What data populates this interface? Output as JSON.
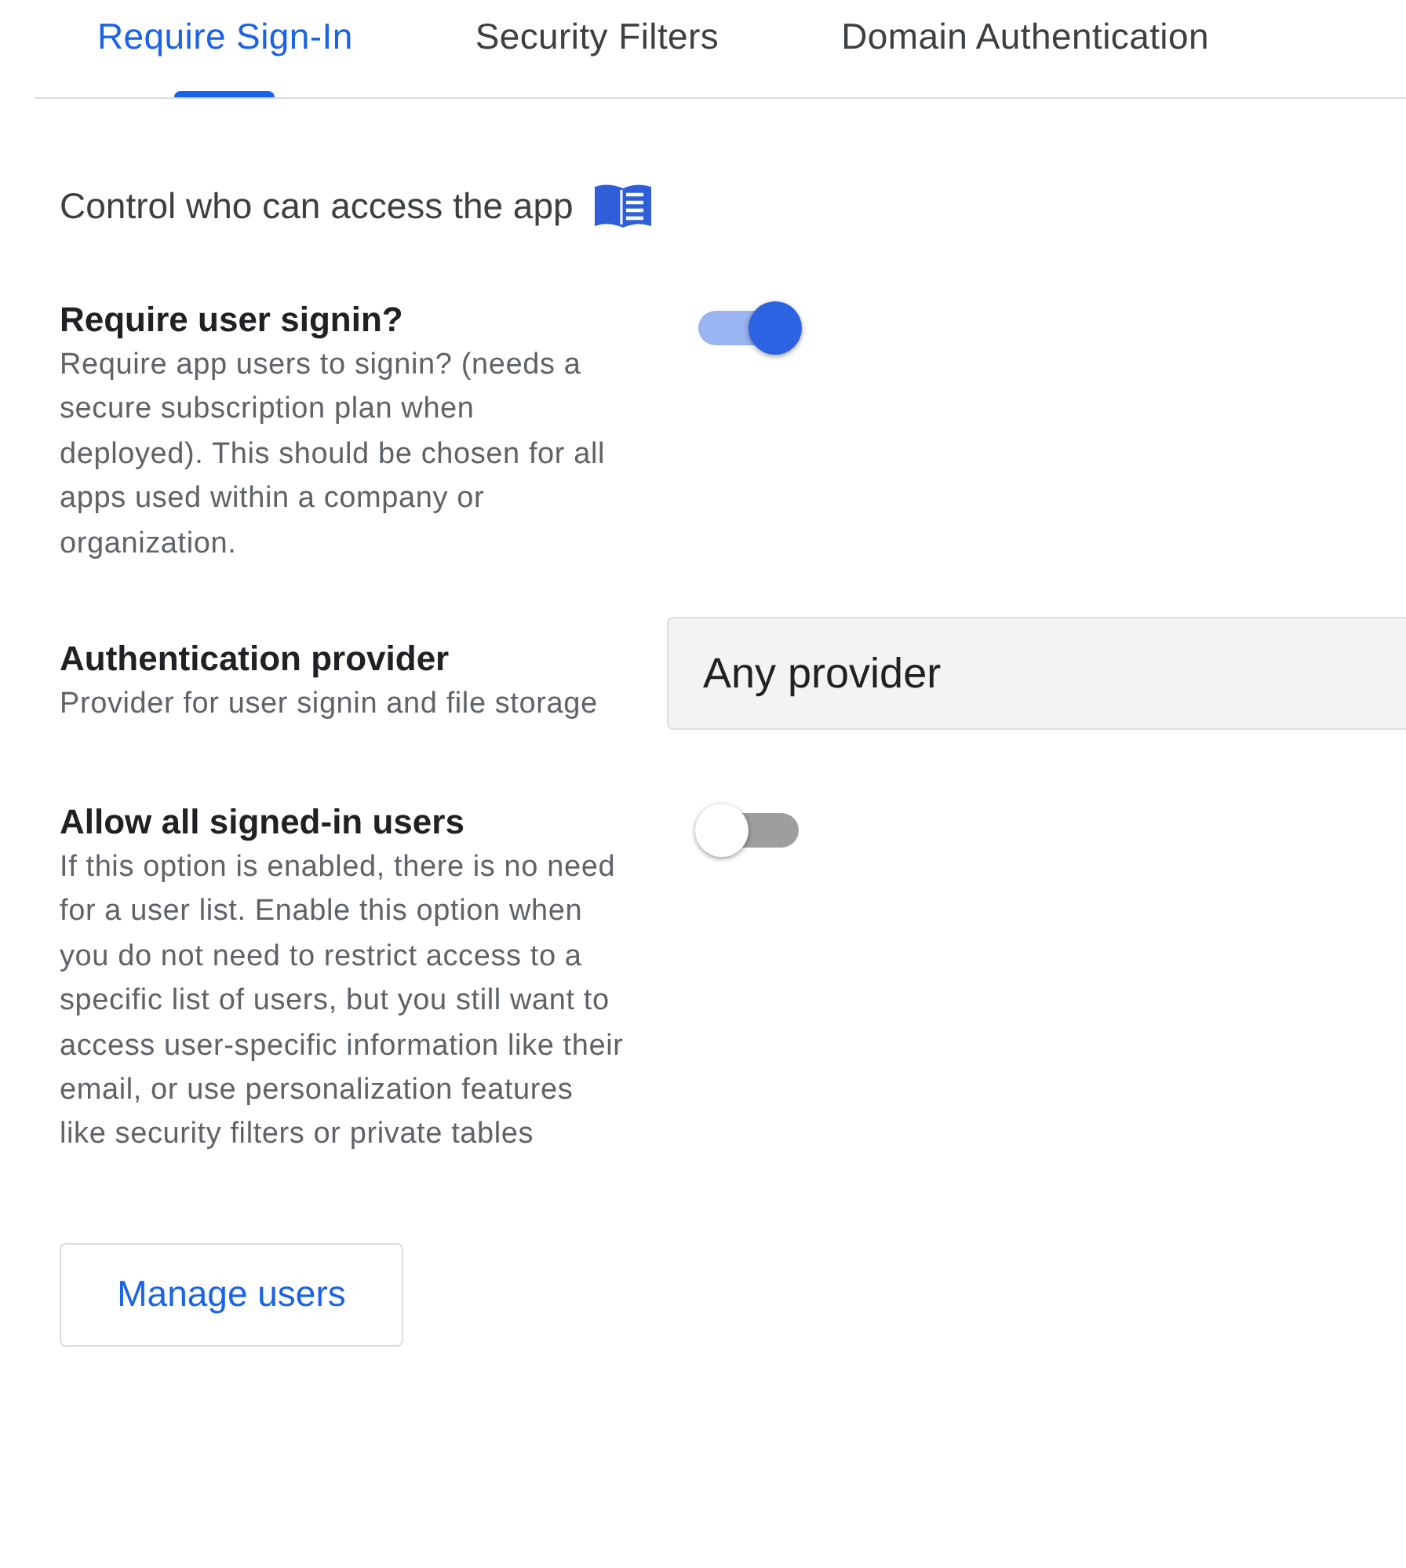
{
  "tabs": [
    {
      "label": "Require Sign-In",
      "selected": true
    },
    {
      "label": "Security Filters",
      "selected": false
    },
    {
      "label": "Domain Authentication",
      "selected": false
    }
  ],
  "intro": "Control who can access the app",
  "settings": [
    {
      "kind": "toggle",
      "title": "Require user signin?",
      "description": "Require app users to signin? (needs a secure subscription plan when deployed). This should be chosen for all apps used within a company or organization.",
      "on": true
    },
    {
      "kind": "select",
      "title": "Authentication provider",
      "description": "Provider for user signin and file storage",
      "value": "Any provider"
    },
    {
      "kind": "toggle",
      "title": "Allow all signed-in users",
      "description": "If this option is enabled, there is no need for a user list. Enable this option when you do not need to restrict access to a specific list of users, but you still want to access user-specific information like their email, or use personalization features like security filters or private tables",
      "on": false
    }
  ],
  "button": "Manage users"
}
